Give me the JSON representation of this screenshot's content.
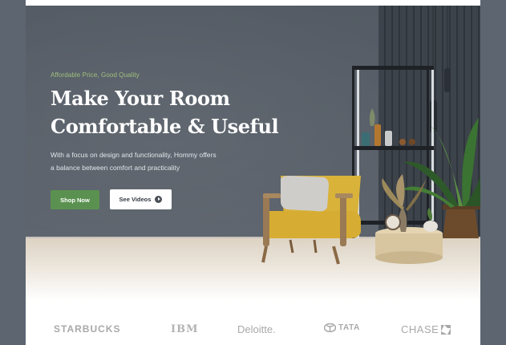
{
  "hero": {
    "eyebrow": "Affordable Price, Good Quality",
    "headline_line1": "Make Your Room",
    "headline_line2": "Comfortable & Useful",
    "description_line1": "With a focus on design and functionality, Hommy offers",
    "description_line2": "a balance between comfort and practicality",
    "shop_button": "Shop Now",
    "video_button": "See Videos",
    "video_icon": "play-icon"
  },
  "brands": {
    "starbucks": "STARBUCKS",
    "ibm": "IBM",
    "deloitte": "Deloitte.",
    "tata": "TATA",
    "chase": "CHASE"
  },
  "colors": {
    "accent_green": "#5a9150",
    "eyebrow_green": "#9fbf7f",
    "wall": "#545b64",
    "chair_yellow": "#d9b23a",
    "brand_gray": "#a9a9a9"
  }
}
